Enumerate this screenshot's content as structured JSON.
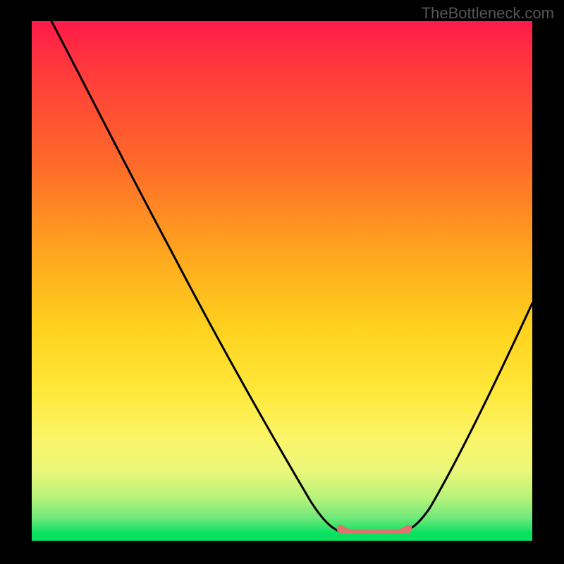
{
  "watermark": "TheBottleneck.com",
  "chart_data": {
    "type": "line",
    "title": "",
    "xlabel": "",
    "ylabel": "",
    "xlim": [
      0,
      100
    ],
    "ylim": [
      0,
      100
    ],
    "grid": false,
    "legend": false,
    "background_gradient": {
      "orientation": "vertical",
      "stops": [
        {
          "pos": 0,
          "color": "#ff1a4a"
        },
        {
          "pos": 50,
          "color": "#ffd21e"
        },
        {
          "pos": 100,
          "color": "#08e060"
        }
      ]
    },
    "series": [
      {
        "name": "bottleneck-curve",
        "color": "#000000",
        "x": [
          4,
          10,
          20,
          30,
          40,
          50,
          58,
          62,
          66,
          70,
          74,
          80,
          88,
          96,
          100
        ],
        "y": [
          100,
          88,
          72,
          56,
          40,
          24,
          10,
          4,
          0,
          0,
          0,
          6,
          22,
          42,
          50
        ]
      }
    ],
    "highlight": {
      "name": "optimal-range",
      "color": "#e0736f",
      "x_start": 62,
      "x_end": 73,
      "y": 0
    }
  }
}
